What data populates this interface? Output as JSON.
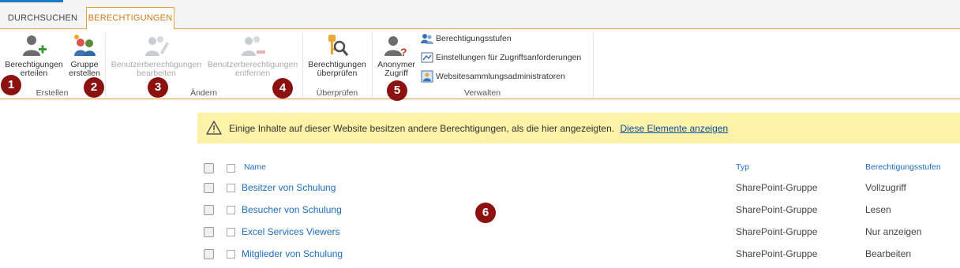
{
  "tabs": {
    "durchsuchen": "DURCHSUCHEN",
    "berechtigungen": "BERECHTIGUNGEN"
  },
  "ribbon": {
    "erstellen": {
      "label": "Erstellen",
      "berechtigungen_line1": "Berechtigungen",
      "berechtigungen_line2": "erteilen",
      "gruppe_line1": "Gruppe",
      "gruppe_line2": "erstellen"
    },
    "aendern": {
      "label": "Ändern",
      "bearbeiten_line1": "Benutzerberechtigungen",
      "bearbeiten_line2": "bearbeiten",
      "entfernen_line1": "Benutzerberechtigungen",
      "entfernen_line2": "entfernen"
    },
    "ueberpruefen": {
      "label": "Überprüfen",
      "btn_line1": "Berechtigungen",
      "btn_line2": "überprüfen"
    },
    "verwalten": {
      "label": "Verwalten",
      "anonym_line1": "Anonymer",
      "anonym_line2": "Zugriff",
      "stufen": "Berechtigungsstufen",
      "einstellungen": "Einstellungen für Zugriffsanforderungen",
      "admins": "Websitesammlungsadministratoren"
    }
  },
  "markers": [
    "1",
    "2",
    "3",
    "4",
    "5",
    "6"
  ],
  "warning": {
    "text": "Einige Inhalte auf dieser Website besitzen andere Berechtigungen, als die hier angezeigten.",
    "link": "Diese Elemente anzeigen"
  },
  "table": {
    "headers": {
      "name": "Name",
      "typ": "Typ",
      "stufen": "Berechtigungsstufen"
    },
    "rows": [
      {
        "name": "Besitzer von Schulung",
        "typ": "SharePoint-Gruppe",
        "stufe": "Vollzugriff"
      },
      {
        "name": "Besucher von Schulung",
        "typ": "SharePoint-Gruppe",
        "stufe": "Lesen"
      },
      {
        "name": "Excel Services Viewers",
        "typ": "SharePoint-Gruppe",
        "stufe": "Nur anzeigen"
      },
      {
        "name": "Mitglieder von Schulung",
        "typ": "SharePoint-Gruppe",
        "stufe": "Bearbeiten"
      }
    ]
  },
  "colors": {
    "accent": "#e1a33a",
    "tab_active_text": "#d07a15",
    "link": "#1f6dbd",
    "marker": "#8c1111",
    "warning_bg": "#fdf2a8"
  }
}
